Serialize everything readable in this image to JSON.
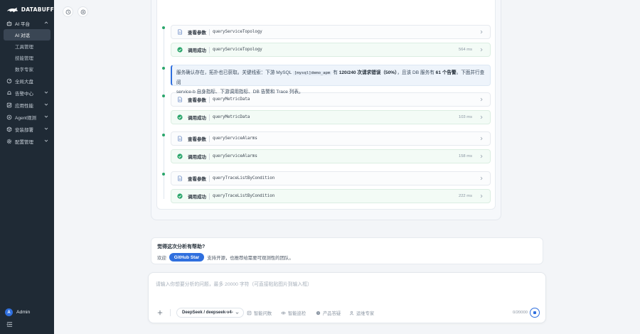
{
  "app": {
    "brand": "DATABUFF"
  },
  "sidebar": {
    "items": [
      {
        "label": "AI 平台",
        "icon": "robot-icon",
        "group": true
      },
      {
        "label": "AI 对话",
        "sub": true,
        "active": true
      },
      {
        "label": "工具管理",
        "sub": true
      },
      {
        "label": "技能管理",
        "sub": true
      },
      {
        "label": "数字专家",
        "sub": true
      },
      {
        "label": "全局大盘",
        "icon": "dashboard-icon"
      },
      {
        "label": "告警中心",
        "icon": "bell-icon",
        "chevron": true
      },
      {
        "label": "应用性能",
        "icon": "chart-icon",
        "chevron": true
      },
      {
        "label": "Agent观测",
        "icon": "agent-icon",
        "chevron": true
      },
      {
        "label": "安装部署",
        "icon": "package-icon",
        "chevron": true
      },
      {
        "label": "配置管理",
        "icon": "gear-icon",
        "chevron": true
      }
    ],
    "user": {
      "initial": "A",
      "name": "Admin"
    }
  },
  "steps": [
    {
      "kind": "params",
      "label": "查看参数",
      "fn": "queryServiceTopology",
      "duration": ""
    },
    {
      "kind": "ok",
      "label": "调用成功",
      "fn": "queryServiceTopology",
      "duration": "564 ms"
    },
    {
      "kind": "params",
      "label": "查看参数",
      "fn": "queryMetricData",
      "duration": ""
    },
    {
      "kind": "ok",
      "label": "调用成功",
      "fn": "queryMetricData",
      "duration": "103 ms"
    },
    {
      "kind": "params",
      "label": "查看参数",
      "fn": "queryServiceAlarms",
      "duration": ""
    },
    {
      "kind": "ok",
      "label": "调用成功",
      "fn": "queryServiceAlarms",
      "duration": "158 ms"
    },
    {
      "kind": "params",
      "label": "查看参数",
      "fn": "queryTraceListByCondition",
      "duration": ""
    },
    {
      "kind": "ok",
      "label": "调用成功",
      "fn": "queryTraceListByCondition",
      "duration": "222 ms"
    }
  ],
  "note": {
    "p1": "服务确认存在，拓扑也已获取。关键线索：下游 MySQL",
    "code": "[mysql]demo_apm",
    "p2": "有",
    "b1": "120/240 次请求错误（50%）",
    "p3": "，且该 DB 服务有",
    "b2": "61 个告警",
    "p4": "。下面并行查阅",
    "line2": "service-b 自身指标、下游调用指标、DB 告警和 Trace 列表。"
  },
  "feedback": {
    "title": "觉得这次分析有帮助?",
    "prefix": "欢迎",
    "button": "GitHub Star",
    "suffix": "支持开源，也推荐给需要可观测性的团队。"
  },
  "composer": {
    "placeholder": "请输入你想要分析的问题，最多 20000 字符（可直接粘贴图片到输入框）",
    "model": "DeepSeek / deepseek-v4-",
    "tools": [
      "智能问数",
      "智能巡检",
      "产品答疑",
      "运维专家"
    ],
    "counter": "0/20000"
  },
  "colors": {
    "accent": "#2f6fde",
    "success": "#2aa66b",
    "sidebar": "#1f2a35"
  }
}
